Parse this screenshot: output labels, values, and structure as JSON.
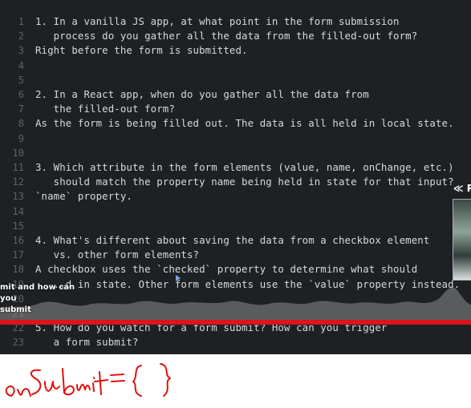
{
  "editor": {
    "lines": [
      {
        "n": "1",
        "t": "1. In a vanilla JS app, at what point in the form submission"
      },
      {
        "n": "2",
        "t": "   process do you gather all the data from the filled-out form?"
      },
      {
        "n": "3",
        "t": "Right before the form is submitted."
      },
      {
        "n": "4",
        "t": ""
      },
      {
        "n": "5",
        "t": ""
      },
      {
        "n": "6",
        "t": "2. In a React app, when do you gather all the data from"
      },
      {
        "n": "7",
        "t": "   the filled-out form?"
      },
      {
        "n": "8",
        "t": "As the form is being filled out. The data is all held in local state."
      },
      {
        "n": "9",
        "t": ""
      },
      {
        "n": "10",
        "t": ""
      },
      {
        "n": "11",
        "t": "3. Which attribute in the form elements (value, name, onChange, etc.)"
      },
      {
        "n": "12",
        "t": "   should match the property name being held in state for that input?"
      },
      {
        "n": "13",
        "t": "`name` property."
      },
      {
        "n": "14",
        "t": ""
      },
      {
        "n": "15",
        "t": ""
      },
      {
        "n": "16",
        "t": "4. What's different about saving the data from a checkbox element"
      },
      {
        "n": "17",
        "t": "   vs. other form elements?"
      },
      {
        "n": "18",
        "t": "A checkbox uses the `checked` property to determine what should"
      },
      {
        "n": "19",
        "t": "  ...d in state. Other form elements use the `value` property instead."
      },
      {
        "n": "20",
        "t": ""
      },
      {
        "n": "21",
        "t": ""
      },
      {
        "n": "22",
        "t": "5. How do you watch for a form submit? How can you trigger"
      },
      {
        "n": "23",
        "t": "   a form submit?"
      }
    ]
  },
  "overlay": {
    "chapter_tip_line1": "mit and how can you",
    "chapter_tip_line2": "submit",
    "preview_label": "≪ P"
  },
  "handwriting": {
    "text": "onSubmit={ }",
    "color": "#e01010"
  },
  "colors": {
    "editor_bg": "#1e2124",
    "progress": "#e0121b"
  }
}
